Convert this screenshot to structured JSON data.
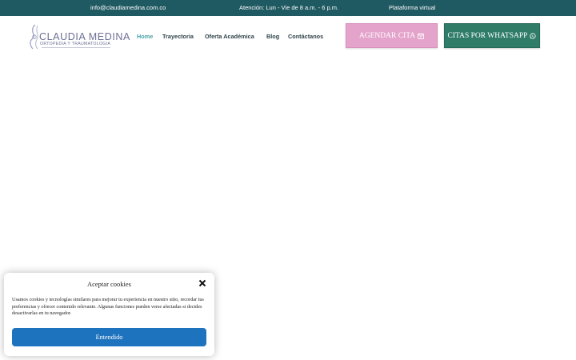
{
  "topbar": {
    "email": "info@claudiamedina.com.co",
    "hours": "Atención: Lun - Vie de 8 a.m. - 6 p.m.",
    "platform": "Plataforma virtual"
  },
  "logo": {
    "name": "CLAUDIA MEDINA",
    "subtitle": "ORTOPEDIA Y TRAUMATOLOGIA"
  },
  "nav": {
    "items": [
      "Home",
      "Trayectoria",
      "Oferta Académica",
      "Blog",
      "Contáctanos"
    ],
    "active": "Home"
  },
  "buttons": {
    "cita_label": "AGENDAR CITA",
    "cita_icon": "calendar-icon",
    "whatsapp_label": "CITAS POR WHATSAPP",
    "whatsapp_icon": "whatsapp-icon"
  },
  "cookie": {
    "title": "Aceptar cookies",
    "text": "Usamos cookies y tecnologías similares para mejorar tu experiencia en nuestro sitio, recordar tus preferencias y ofrecer contenido relevante. Algunas funciones pueden verse afectadas si decides desactivarlas en tu navegador.",
    "accept_label": "Entendido",
    "close_icon": "close-icon"
  },
  "colors": {
    "topbar_bg": "#1f5961",
    "nav_active": "#4aa3a6",
    "cita_bg": "#e4a3cb",
    "whatsapp_bg": "#2f7d69",
    "cookie_button_bg": "#1e73be"
  }
}
